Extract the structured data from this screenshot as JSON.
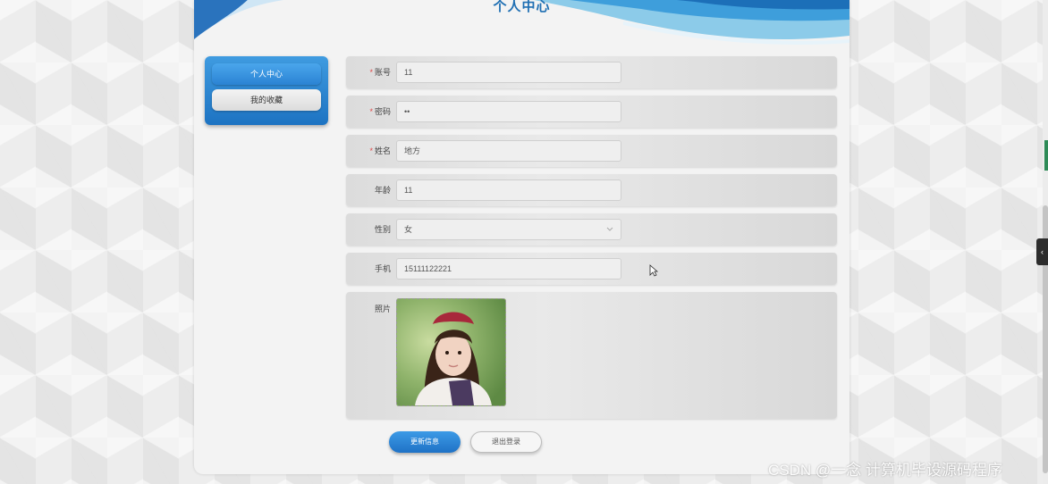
{
  "page": {
    "title": "个人中心"
  },
  "side_menu": {
    "items": [
      {
        "label": "个人中心",
        "active": true
      },
      {
        "label": "我的收藏",
        "active": false
      }
    ]
  },
  "form": {
    "account": {
      "label": "账号",
      "required": "*",
      "value": "11"
    },
    "password": {
      "label": "密码",
      "required": "*",
      "value": "••"
    },
    "name": {
      "label": "姓名",
      "required": "*",
      "value": "地方"
    },
    "age": {
      "label": "年龄",
      "value": "11"
    },
    "gender": {
      "label": "性别",
      "value": "女"
    },
    "phone": {
      "label": "手机",
      "value": "15111122221"
    },
    "photo": {
      "label": "照片"
    }
  },
  "buttons": {
    "update": "更新信息",
    "logout": "退出登录"
  },
  "watermark": "CSDN @一念 计算机毕设源码程序",
  "colors": {
    "accent": "#2b83d3",
    "title": "#1f6fb3",
    "required": "#e04a4a"
  },
  "icons": {
    "select_arrow": "chevron-down-icon",
    "collapse": "chevron-left-icon",
    "cursor": "mouse-pointer-icon"
  }
}
